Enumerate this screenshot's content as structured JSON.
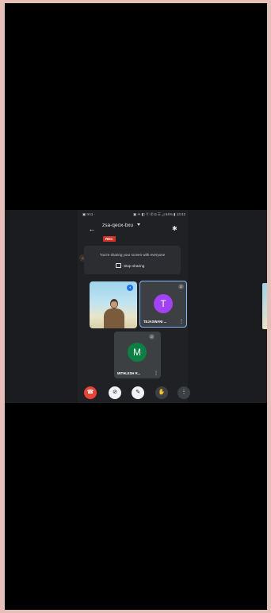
{
  "status_bar": {
    "left": "▣ ✉ ◘ ·",
    "right": "▣ ✈ ◧ ⓝ ✆ ◘ ☰ ◿ 64% ▮ 13:42"
  },
  "meeting": {
    "code": "zsa-qeox-bxu",
    "rec_label": "REC"
  },
  "share_banner": {
    "message": "You're sharing your screen with everyone",
    "stop_label": "Stop sharing"
  },
  "participants": [
    {
      "name": "",
      "type": "video"
    },
    {
      "name": "TEJASWANI ...",
      "initial": "T",
      "avatar_color": "#a142f4"
    },
    {
      "name": "MITHLESH R...",
      "initial": "M",
      "avatar_color": "#0b8043"
    }
  ],
  "side_tab_left": "☺",
  "controls": {
    "end_call": "☎",
    "camera": "⊘",
    "mic": "✎",
    "hand": "✋",
    "more": "⋮"
  },
  "colors": {
    "end_call": "#ea4335",
    "rec": "#d93025",
    "active_border": "#8ab4f8"
  }
}
